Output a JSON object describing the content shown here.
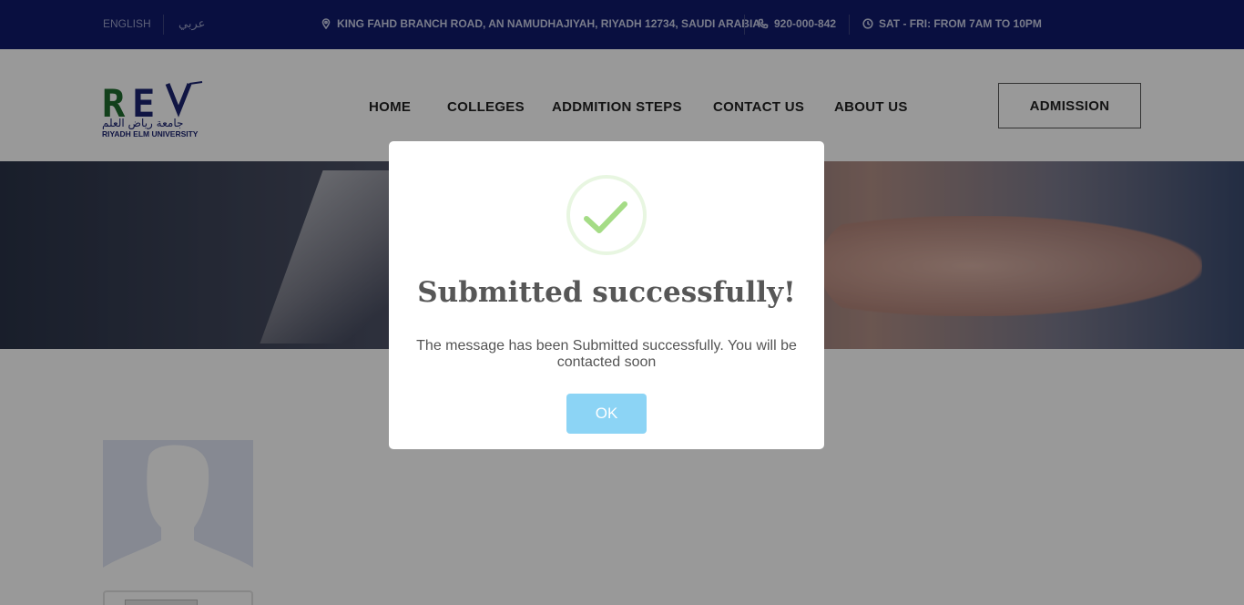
{
  "topbar": {
    "lang_english": "ENGLISH",
    "lang_arabic": "عربي",
    "address": "KING FAHD BRANCH ROAD, AN NAMUDHAJIYAH, RIYADH 12734, SAUDI ARABIA",
    "phone": "920-000-842",
    "hours": "SAT - FRI: FROM 7AM TO 10PM",
    "icons": [
      "map-pin-icon",
      "phone-icon",
      "clock-icon"
    ]
  },
  "header": {
    "logo_text": "REU",
    "logo_arabic": "جامعة رياض العلم",
    "logo_english": "RIYADH ELM UNIVERSITY",
    "nav": [
      "HOME",
      "COLLEGES",
      "ADDMITION STEPS",
      "CONTACT US",
      "ABOUT US"
    ],
    "admission_label": "ADMISSION"
  },
  "modal": {
    "title": "Submitted successfully!",
    "message": "The message has been Submitted successfully. You will be contacted soon",
    "ok_label": "OK",
    "icon": "success-check-icon"
  },
  "colors": {
    "topbar": "#101a6c",
    "success": "#a5dc86",
    "ok_button": "#8cd4f5"
  }
}
